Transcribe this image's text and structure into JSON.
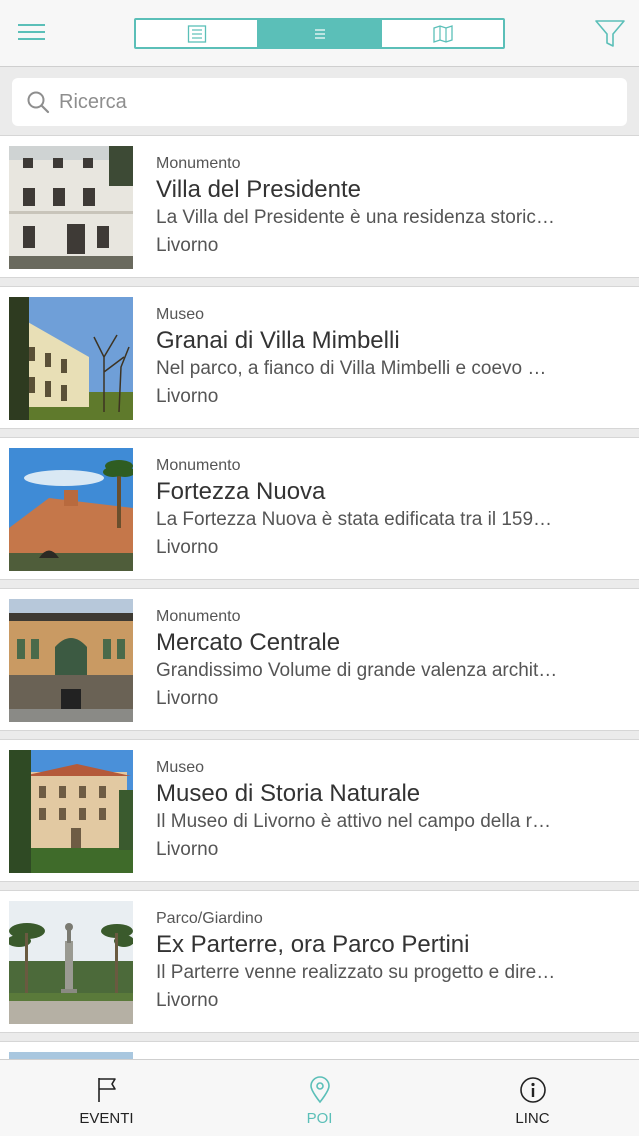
{
  "header": {
    "colors": {
      "accent": "#5bbfb8"
    },
    "icons": [
      "menu-icon",
      "grid-list-icon",
      "list-icon",
      "map-icon",
      "filter-icon"
    ]
  },
  "search": {
    "placeholder": "Ricerca",
    "value": ""
  },
  "items": [
    {
      "category": "Monumento",
      "title": "Villa del Presidente",
      "description": "La Villa del Presidente è una residenza storic…",
      "city": "Livorno"
    },
    {
      "category": "Museo",
      "title": "Granai di Villa Mimbelli",
      "description": "Nel parco, a fianco di Villa Mimbelli e coevo …",
      "city": "Livorno"
    },
    {
      "category": "Monumento",
      "title": "Fortezza Nuova",
      "description": "La Fortezza Nuova è stata edificata tra il 159…",
      "city": "Livorno"
    },
    {
      "category": "Monumento",
      "title": "Mercato Centrale",
      "description": "Grandissimo Volume di grande valenza archit…",
      "city": "Livorno"
    },
    {
      "category": "Museo",
      "title": "Museo di Storia Naturale",
      "description": "Il Museo di Livorno è attivo nel campo della r…",
      "city": "Livorno"
    },
    {
      "category": "Parco/Giardino",
      "title": "Ex Parterre, ora Parco Pertini",
      "description": "Il Parterre venne realizzato su progetto e dire…",
      "city": "Livorno"
    }
  ],
  "tabs": [
    {
      "label": "EVENTI",
      "icon": "flag-icon"
    },
    {
      "label": "POI",
      "icon": "location-pin-icon",
      "active": true
    },
    {
      "label": "LINC",
      "icon": "info-icon"
    }
  ]
}
